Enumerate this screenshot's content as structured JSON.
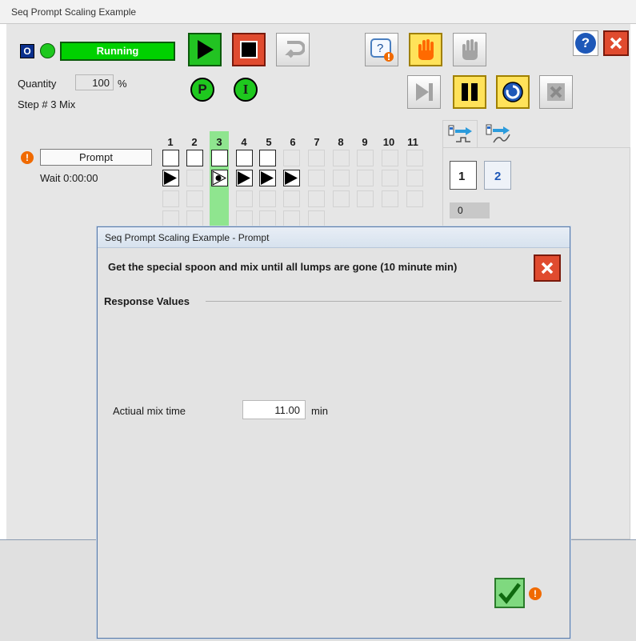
{
  "window": {
    "title": "Seq Prompt Scaling Example"
  },
  "status": {
    "mode_letter": "O",
    "state_text": "Running",
    "accent": "#00d100"
  },
  "quantity": {
    "label": "Quantity",
    "value": "100",
    "unit": "%"
  },
  "step": {
    "label": "Step # 3 Mix"
  },
  "indicators": {
    "p": "P",
    "i": "I"
  },
  "prompt": {
    "button_label": "Prompt",
    "wait_text": "Wait 0:00:00"
  },
  "grid": {
    "columns": [
      "1",
      "2",
      "3",
      "4",
      "5",
      "6",
      "7",
      "8",
      "9",
      "10",
      "11"
    ],
    "active_column": "3"
  },
  "pages": {
    "tab1": "1",
    "tab2": "2",
    "counter": "0"
  },
  "dialog": {
    "title": "Seq Prompt Scaling Example - Prompt",
    "message": "Get the special spoon and mix until all lumps are gone (10 minute min)",
    "section_heading": "Response Values",
    "field_label": "Actiual mix time",
    "field_value": "11.00",
    "field_unit": "min"
  },
  "icons": {
    "help": "help-icon",
    "close": "close-icon",
    "confirm": "checkmark-icon",
    "warning": "warning-icon"
  }
}
